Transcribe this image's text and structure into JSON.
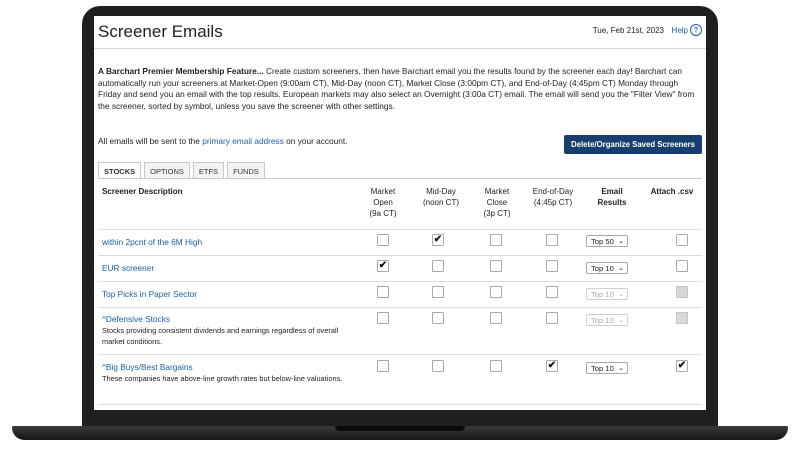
{
  "header": {
    "title": "Screener Emails",
    "date": "Tue, Feb 21st, 2023",
    "help_label": "Help"
  },
  "intro": {
    "feature_label": "A Barchart Premier Membership Feature...",
    "body": "Create custom screeners, then have Barchart email you the results found by the screener each day! Barchart can automatically run your screeners at Market-Open (9:00am CT), Mid-Day (noon CT), Market Close (3:00pm CT), and End-of-Day (4:45pm CT) Monday through Friday and send you an email with the top results. European markets may also select an Overnight (3:00a CT) email. The email will send you the \"Filter View\" from the screener, sorted by symbol, unless you save the screener with other settings."
  },
  "notice": {
    "prefix": "All emails will be sent to the",
    "link": "primary email address",
    "suffix": "on your account."
  },
  "button": {
    "label": "Delete/Organize Saved Screeners"
  },
  "tabs": [
    "STOCKS",
    "OPTIONS",
    "ETFS",
    "FUNDS"
  ],
  "columns": {
    "description": "Screener Description",
    "market_open": [
      "Market",
      "Open",
      "(9a CT)"
    ],
    "mid_day": [
      "Mid-Day",
      "(noon CT)"
    ],
    "market_close": [
      "Market",
      "Close",
      "(3p CT)"
    ],
    "end_of_day": [
      "End-of-Day",
      "(4:45p CT)"
    ],
    "email_results": [
      "Email",
      "Results"
    ],
    "attach": "Attach .csv"
  },
  "rows": [
    {
      "name": "within 2pcnt of the 6M High",
      "description": "",
      "results": "Top 50"
    },
    {
      "name": "EUR screener",
      "description": "",
      "results": "Top 10"
    },
    {
      "name": "Top Picks in Paper Sector",
      "description": "",
      "results": "Top 10"
    },
    {
      "name": "^Defensive Stocks",
      "description": "Stocks providing consistent dividends and earnings regardless of overall market conditions.",
      "results": "Top 10"
    },
    {
      "name": "^Big Buys/Best Bargains",
      "description": "These companies have above-line growth rates but below-line valuations.",
      "results": "Top 10"
    }
  ],
  "checks": {
    "mark": "✔",
    "row0": {
      "mid_day": "✔"
    },
    "row1": {
      "market_open": "✔"
    },
    "row4": {
      "end_of_day": "✔",
      "attach": "✔"
    }
  }
}
